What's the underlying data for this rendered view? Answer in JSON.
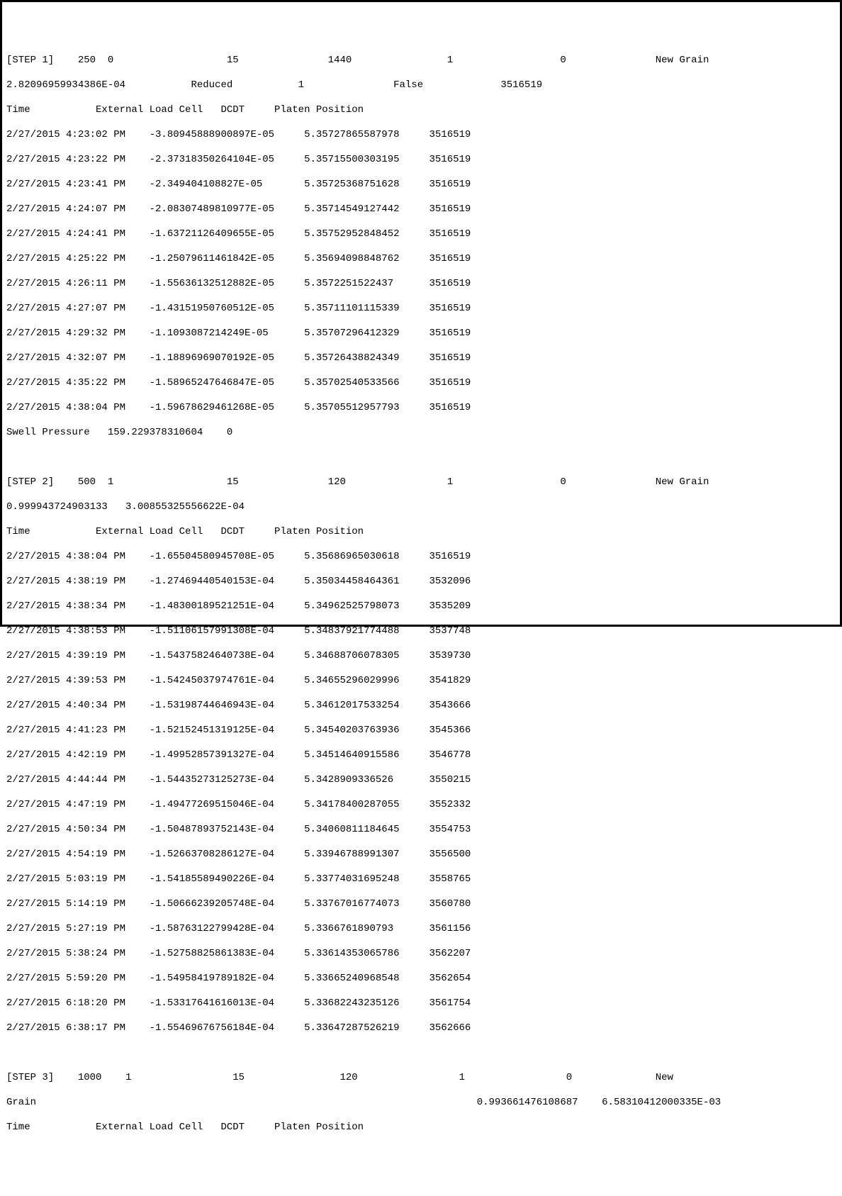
{
  "step1": {
    "header": "[STEP 1]    250  0                   15               1440                1                  0               New Grain",
    "params": "2.82096959934386E-04           Reduced           1               False             3516519",
    "cols": "Time           External Load Cell   DCDT     Platen Position",
    "rows": [
      "2/27/2015 4:23:02 PM    -3.80945888900897E-05     5.35727865587978     3516519",
      "2/27/2015 4:23:22 PM    -2.37318350264104E-05     5.35715500303195     3516519",
      "2/27/2015 4:23:41 PM    -2.349404108827E-05       5.35725368751628     3516519",
      "2/27/2015 4:24:07 PM    -2.08307489810977E-05     5.35714549127442     3516519",
      "2/27/2015 4:24:41 PM    -1.63721126409655E-05     5.35752952848452     3516519",
      "2/27/2015 4:25:22 PM    -1.25079611461842E-05     5.35694098848762     3516519",
      "2/27/2015 4:26:11 PM    -1.55636132512882E-05     5.3572251522437      3516519",
      "2/27/2015 4:27:07 PM    -1.43151950760512E-05     5.35711101115339     3516519",
      "2/27/2015 4:29:32 PM    -1.1093087214249E-05      5.35707296412329     3516519",
      "2/27/2015 4:32:07 PM    -1.18896969070192E-05     5.35726438824349     3516519",
      "2/27/2015 4:35:22 PM    -1.58965247646847E-05     5.35702540533566     3516519",
      "2/27/2015 4:38:04 PM    -1.59678629461268E-05     5.35705512957793     3516519"
    ],
    "swell": "Swell Pressure   159.229378310604    0"
  },
  "step2": {
    "header": "[STEP 2]    500  1                   15               120                 1                  0               New Grain",
    "params": "0.999943724903133   3.00855325556622E-04",
    "cols": "Time           External Load Cell   DCDT     Platen Position",
    "rows": [
      "2/27/2015 4:38:04 PM    -1.65504580945708E-05     5.35686965030618     3516519",
      "2/27/2015 4:38:19 PM    -1.27469440540153E-04     5.35034458464361     3532096",
      "2/27/2015 4:38:34 PM    -1.48300189521251E-04     5.34962525798073     3535209",
      "2/27/2015 4:38:53 PM    -1.51106157991308E-04     5.34837921774488     3537748",
      "2/27/2015 4:39:19 PM    -1.54375824640738E-04     5.34688706078305     3539730",
      "2/27/2015 4:39:53 PM    -1.54245037974761E-04     5.34655296029996     3541829",
      "2/27/2015 4:40:34 PM    -1.53198744646943E-04     5.34612017533254     3543666",
      "2/27/2015 4:41:23 PM    -1.52152451319125E-04     5.34540203763936     3545366",
      "2/27/2015 4:42:19 PM    -1.49952857391327E-04     5.34514640915586     3546778",
      "2/27/2015 4:44:44 PM    -1.54435273125273E-04     5.3428909336526      3550215",
      "2/27/2015 4:47:19 PM    -1.49477269515046E-04     5.34178400287055     3552332",
      "2/27/2015 4:50:34 PM    -1.50487893752143E-04     5.34060811184645     3554753",
      "2/27/2015 4:54:19 PM    -1.52663708286127E-04     5.33946788991307     3556500",
      "2/27/2015 5:03:19 PM    -1.54185589490226E-04     5.33774031695248     3558765",
      "2/27/2015 5:14:19 PM    -1.50666239205748E-04     5.33767016774073     3560780",
      "2/27/2015 5:27:19 PM    -1.58763122799428E-04     5.3366761890793      3561156",
      "2/27/2015 5:38:24 PM    -1.52758825861383E-04     5.33614353065786     3562207",
      "2/27/2015 5:59:20 PM    -1.54958419789182E-04     5.33665240968548     3562654",
      "2/27/2015 6:18:20 PM    -1.53317641616013E-04     5.33682243235126     3561754",
      "2/27/2015 6:38:17 PM    -1.55469676756184E-04     5.33647287526219     3562666"
    ]
  },
  "step3": {
    "header": "[STEP 3]    1000    1                 15                120                 1                 0              New",
    "params": "Grain                                                                          0.993661476108687    6.58310412000335E-03",
    "cols": "Time           External Load Cell   DCDT     Platen Position"
  }
}
